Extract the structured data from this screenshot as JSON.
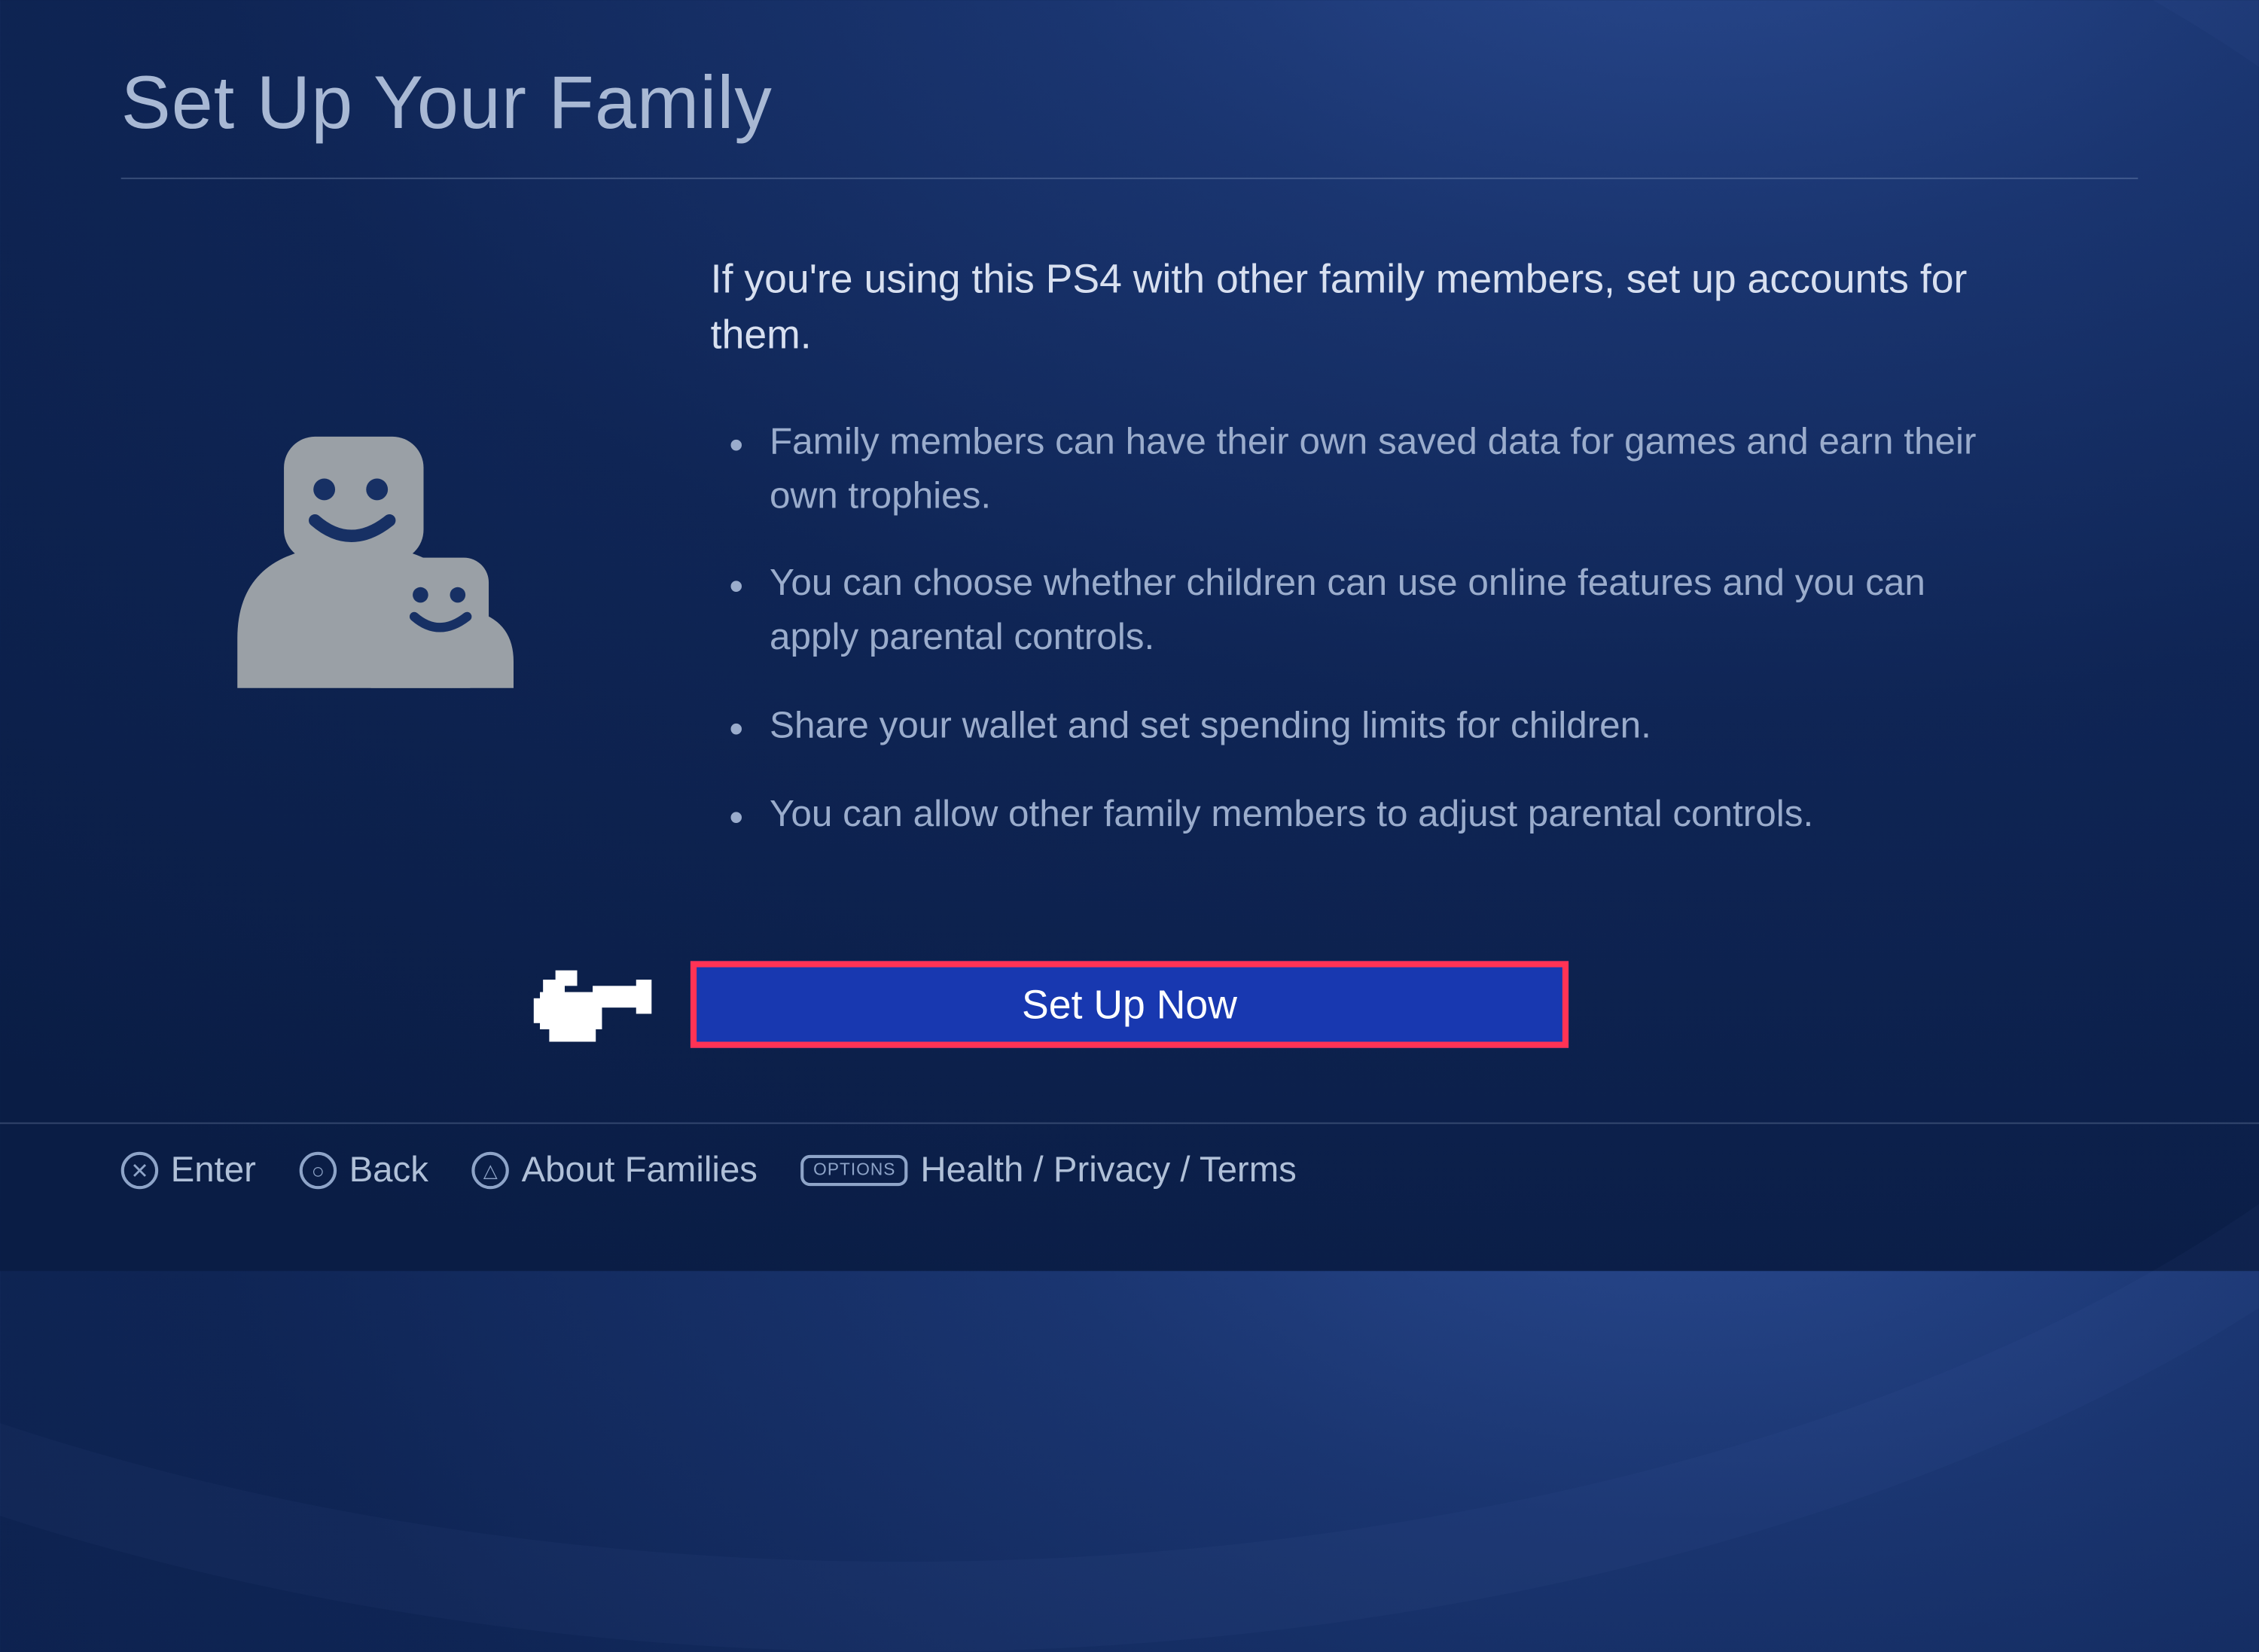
{
  "title": "Set Up Your Family",
  "intro": "If you're using this PS4 with other family members, set up accounts for them.",
  "features": [
    "Family members can have their own saved data for games and earn their own trophies.",
    "You can choose whether children can use online features and you can apply parental controls.",
    "Share your wallet and set spending limits for children.",
    "You can allow other family members to adjust parental controls."
  ],
  "primary_button": "Set Up Now",
  "footer": {
    "enter": "Enter",
    "back": "Back",
    "about": "About Families",
    "options_label": "OPTIONS",
    "legal": "Health / Privacy / Terms"
  }
}
